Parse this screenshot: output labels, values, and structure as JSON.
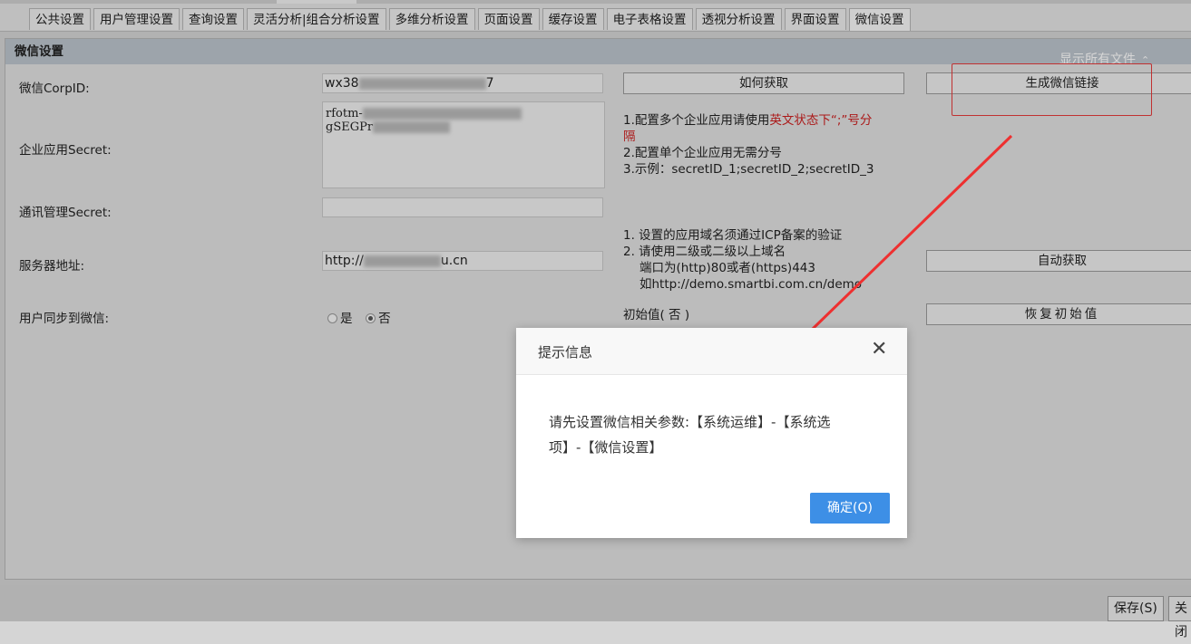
{
  "tabs": [
    "公共设置",
    "用户管理设置",
    "查询设置",
    "灵活分析|组合分析设置",
    "多维分析设置",
    "页面设置",
    "缓存设置",
    "电子表格设置",
    "透视分析设置",
    "界面设置",
    "微信设置"
  ],
  "active_tab": "微信设置",
  "panel": {
    "title": "微信设置",
    "show_all_files": "显示所有文件"
  },
  "form": {
    "corpid_label": "微信CorpID:",
    "corpid_value_prefix": "wx38",
    "corpid_value_suffix": "7",
    "secret_label": "企业应用Secret:",
    "secret_line1": "rfotm-",
    "secret_line2": "gSEGPr",
    "address_book_label": "通讯管理Secret:",
    "server_label": "服务器地址:",
    "server_value_prefix": "http://",
    "server_value_suffix": "u.cn",
    "sync_label": "用户同步到微信:",
    "radio_yes": "是",
    "radio_no": "否"
  },
  "buttons": {
    "how_to_get": "如何获取",
    "generate_link": "生成微信链接",
    "auto_get": "自动获取",
    "restore_default": "恢复初始值",
    "save": "保存(S)",
    "close": "关闭"
  },
  "notes": {
    "secret_1a": "1.配置多个企业应用请使用",
    "secret_1b": "英文状态下“;”号分",
    "secret_1c": "隔",
    "secret_2": "2.配置单个企业应用无需分号",
    "secret_3": "3.示例：secretID_1;secretID_2;secretID_3",
    "server_1": "1. 设置的应用域名须通过ICP备案的验证",
    "server_2": "2. 请使用二级或二级以上域名",
    "server_3": "端口为(http)80或者(https)443",
    "server_4": "如http://demo.smartbi.com.cn/demo",
    "sync_default": "初始值( 否 )"
  },
  "dialog": {
    "title": "提示信息",
    "line1": "请先设置微信相关参数:【系统运维】-【系统选",
    "line2": "项】-【微信设置】",
    "ok": "确定(O)"
  },
  "colors": {
    "annotation_red": "#e53b3b",
    "primary_blue": "#3d8fe6",
    "note_red": "#cc2020"
  }
}
